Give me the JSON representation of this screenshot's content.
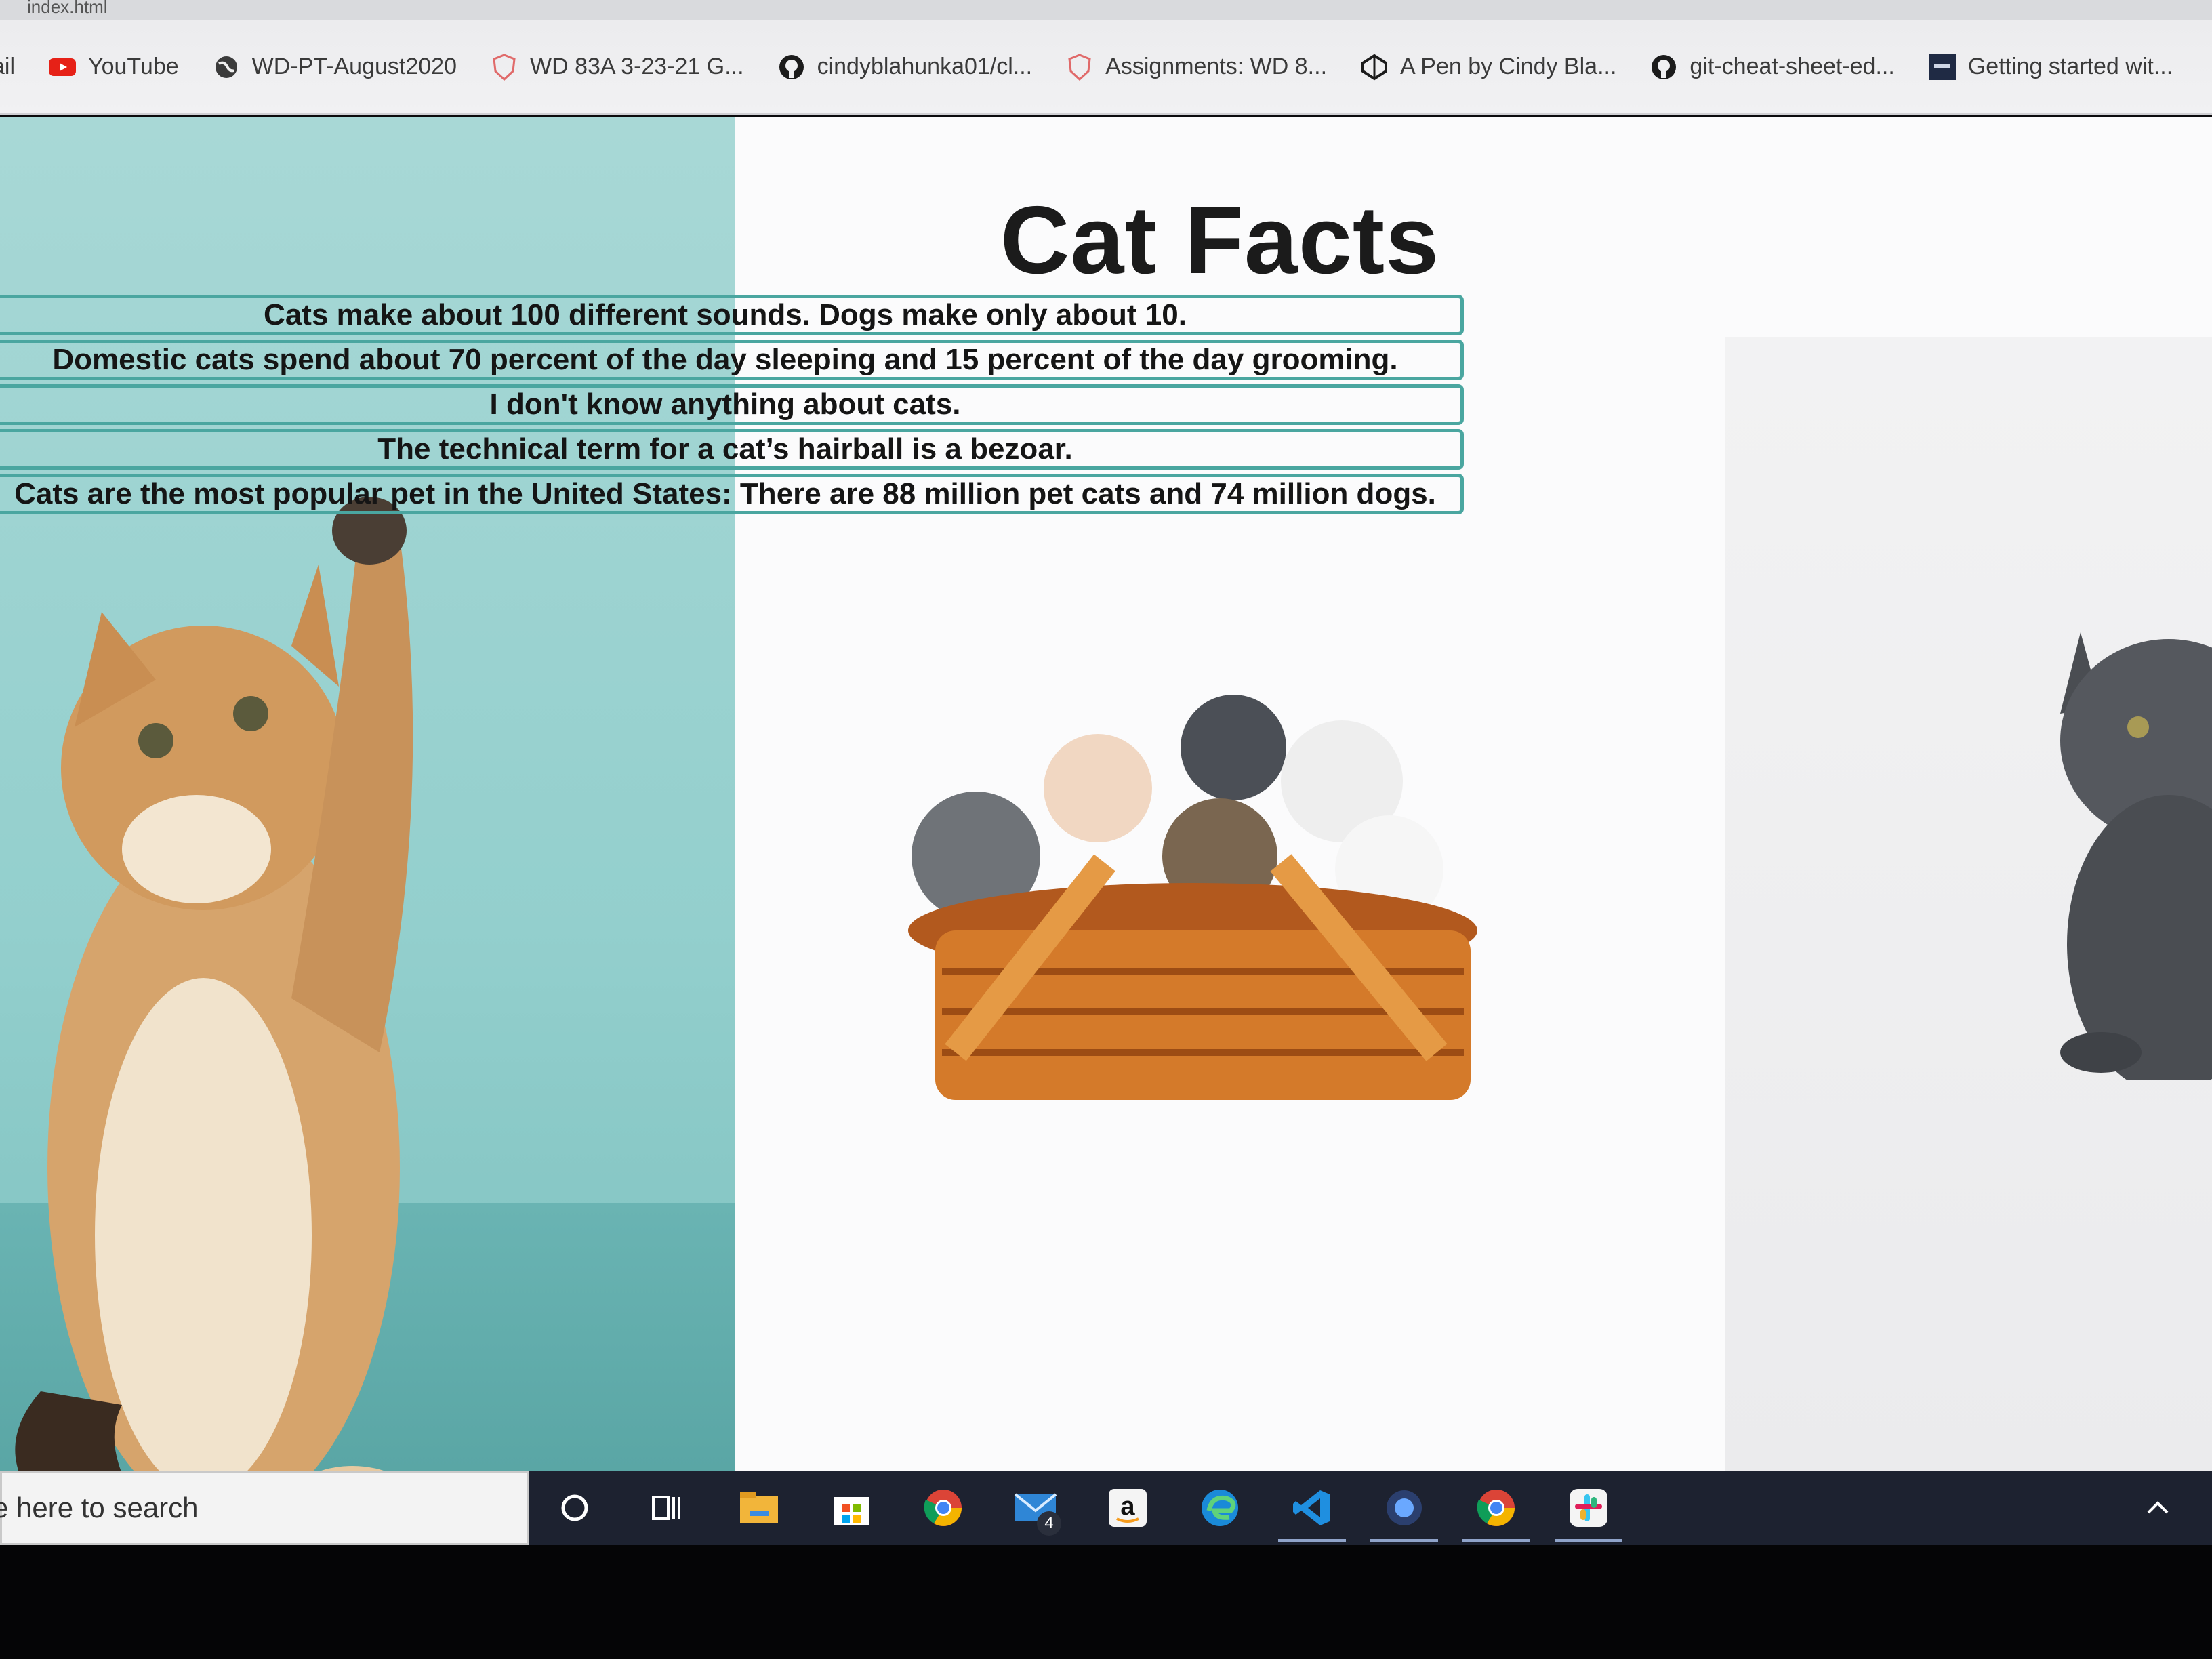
{
  "browser": {
    "url_fragment": "index.html",
    "bookmarks": [
      {
        "label": "ail",
        "icon": "none"
      },
      {
        "label": "YouTube",
        "icon": "youtube-icon"
      },
      {
        "label": "WD-PT-August2020",
        "icon": "globe-icon"
      },
      {
        "label": "WD 83A 3-23-21 G...",
        "icon": "shield-icon"
      },
      {
        "label": "cindyblahunka01/cl...",
        "icon": "github-icon"
      },
      {
        "label": "Assignments: WD 8...",
        "icon": "shield-icon"
      },
      {
        "label": "A Pen by Cindy Bla...",
        "icon": "codepen-icon"
      },
      {
        "label": "git-cheat-sheet-ed...",
        "icon": "github-icon"
      },
      {
        "label": "Getting started wit...",
        "icon": "docs-icon"
      }
    ]
  },
  "page": {
    "title": "Cat Facts",
    "facts": [
      "Cats make about 100 different sounds. Dogs make only about 10.",
      "Domestic cats spend about 70 percent of the day sleeping and 15 percent of the day grooming.",
      "I don't know anything about cats.",
      "The technical term for a cat’s hairball is a bezoar.",
      "Cats are the most popular pet in the United States: There are 88 million pet cats and 74 million dogs."
    ],
    "colors": {
      "fact_border": "#4aa6a0",
      "left_background": "#9fd4d2"
    }
  },
  "taskbar": {
    "search_placeholder": "e here to search",
    "mail_badge": "4",
    "icons": [
      "cortana-icon",
      "task-view-icon",
      "file-explorer-icon",
      "store-icon",
      "chrome-icon",
      "mail-icon",
      "amazon-icon",
      "edge-icon",
      "vscode-icon",
      "app-icon",
      "chrome-canary-icon",
      "slack-icon"
    ]
  }
}
